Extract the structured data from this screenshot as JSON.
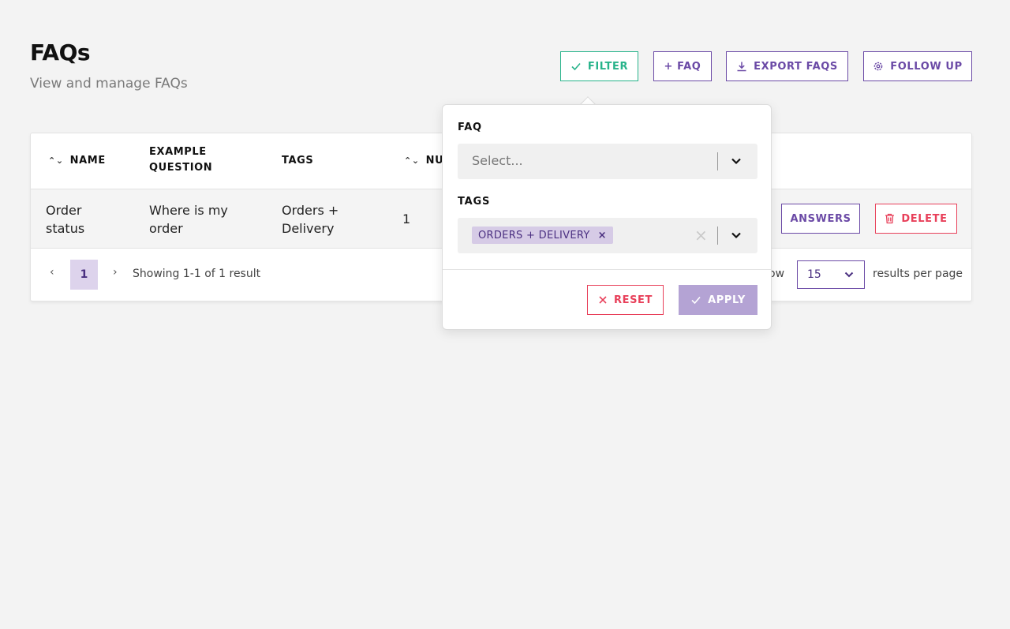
{
  "header": {
    "title": "FAQs",
    "subtitle": "View and manage FAQs"
  },
  "toolbar": {
    "filter_label": "FILTER",
    "add_label": "+ FAQ",
    "export_label": "EXPORT FAQS",
    "follow_up_label": "FOLLOW UP"
  },
  "table": {
    "columns": {
      "name": "NAME",
      "example_question_1": "EXAMPLE",
      "example_question_2": "QUESTION",
      "tags": "TAGS",
      "number": "NU"
    },
    "rows": [
      {
        "name_1": "Order",
        "name_2": "status",
        "question_1": "Where is my",
        "question_2": "order",
        "tags_1": "Orders +",
        "tags_2": "Delivery",
        "number": "1",
        "answers_label": "ANSWERS",
        "delete_label": "DELETE"
      }
    ]
  },
  "pagination": {
    "prev": "‹",
    "next": "›",
    "current_page": "1",
    "showing": "Showing 1-1 of 1 result",
    "show_label": "ow",
    "per_page_value": "15",
    "per_page_label": "results per page"
  },
  "filter_popover": {
    "faq_label": "FAQ",
    "faq_placeholder": "Select...",
    "tags_label": "TAGS",
    "tag_chip": "ORDERS + DELIVERY",
    "chip_remove": "×",
    "clear": "×",
    "reset_label": "RESET",
    "apply_label": "APPLY"
  },
  "colors": {
    "accent_purple": "#6b4aa6",
    "filter_green": "#27b38a",
    "delete_red": "#e8405a",
    "apply_disabled": "#b4a3d4"
  }
}
